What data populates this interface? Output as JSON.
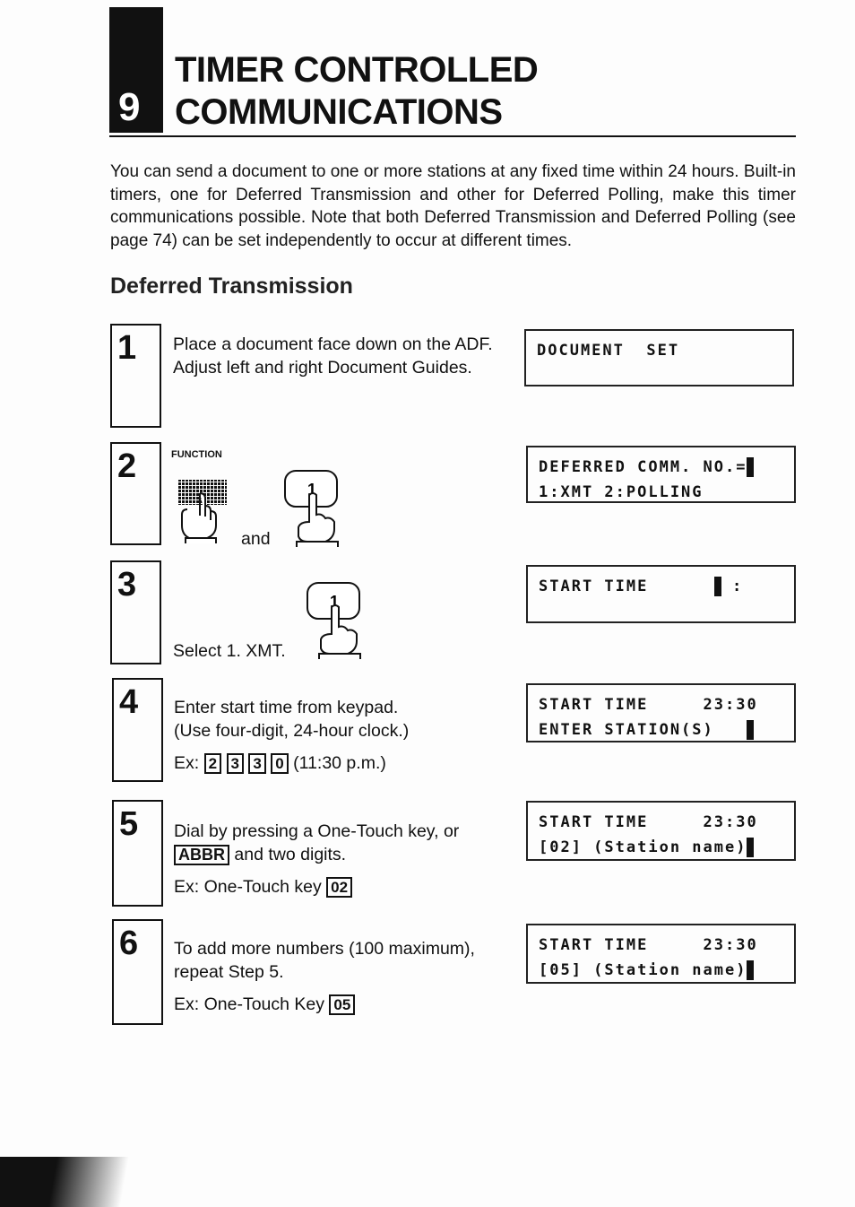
{
  "chapter": {
    "number": "9",
    "title_line1": "TIMER CONTROLLED",
    "title_line2": "COMMUNICATIONS"
  },
  "intro": "You can send a document to one or more stations at any fixed time within 24 hours. Built-in timers, one for Deferred Transmission and other for Deferred Polling, make this timer communications possible. Note that both Deferred Transmission and Deferred Polling (see page 74) can be set independently to occur at different times.",
  "section_heading": "Deferred Transmission",
  "steps": [
    {
      "num": "1",
      "line1": "Place a document face down on the ADF.",
      "line2": "Adjust left and right Document Guides.",
      "lcd1": "DOCUMENT  SET",
      "lcd2": ""
    },
    {
      "num": "2",
      "function_label": "FUNCTION",
      "and": "and",
      "key": "1",
      "lcd1": "DEFERRED COMM. NO.=",
      "lcd2": "1:XMT 2:POLLING"
    },
    {
      "num": "3",
      "text": "Select 1. XMT.",
      "key": "1",
      "lcd1": "START TIME      ",
      "lcd1b": " :",
      "lcd2": ""
    },
    {
      "num": "4",
      "line1": "Enter start time from keypad.",
      "line2": "(Use four-digit, 24-hour clock.)",
      "ex": "Ex:",
      "keys": [
        "2",
        "3",
        "3",
        "0"
      ],
      "ex_note": "(11:30 p.m.)",
      "lcd1": "START TIME     23:30",
      "lcd2": "ENTER STATION(S)   "
    },
    {
      "num": "5",
      "line1": "Dial by pressing a One-Touch key, or",
      "abbr": "ABBR",
      "line2": "and two digits.",
      "ex": "Ex: One-Touch key",
      "key": "02",
      "lcd1": "START TIME     23:30",
      "lcd2": "[02] (Station name)"
    },
    {
      "num": "6",
      "line1": "To add more numbers (100 maximum),",
      "line2": "repeat Step 5.",
      "ex": "Ex: One-Touch Key",
      "key": "05",
      "lcd1": "START TIME     23:30",
      "lcd2": "[05] (Station name)"
    }
  ]
}
